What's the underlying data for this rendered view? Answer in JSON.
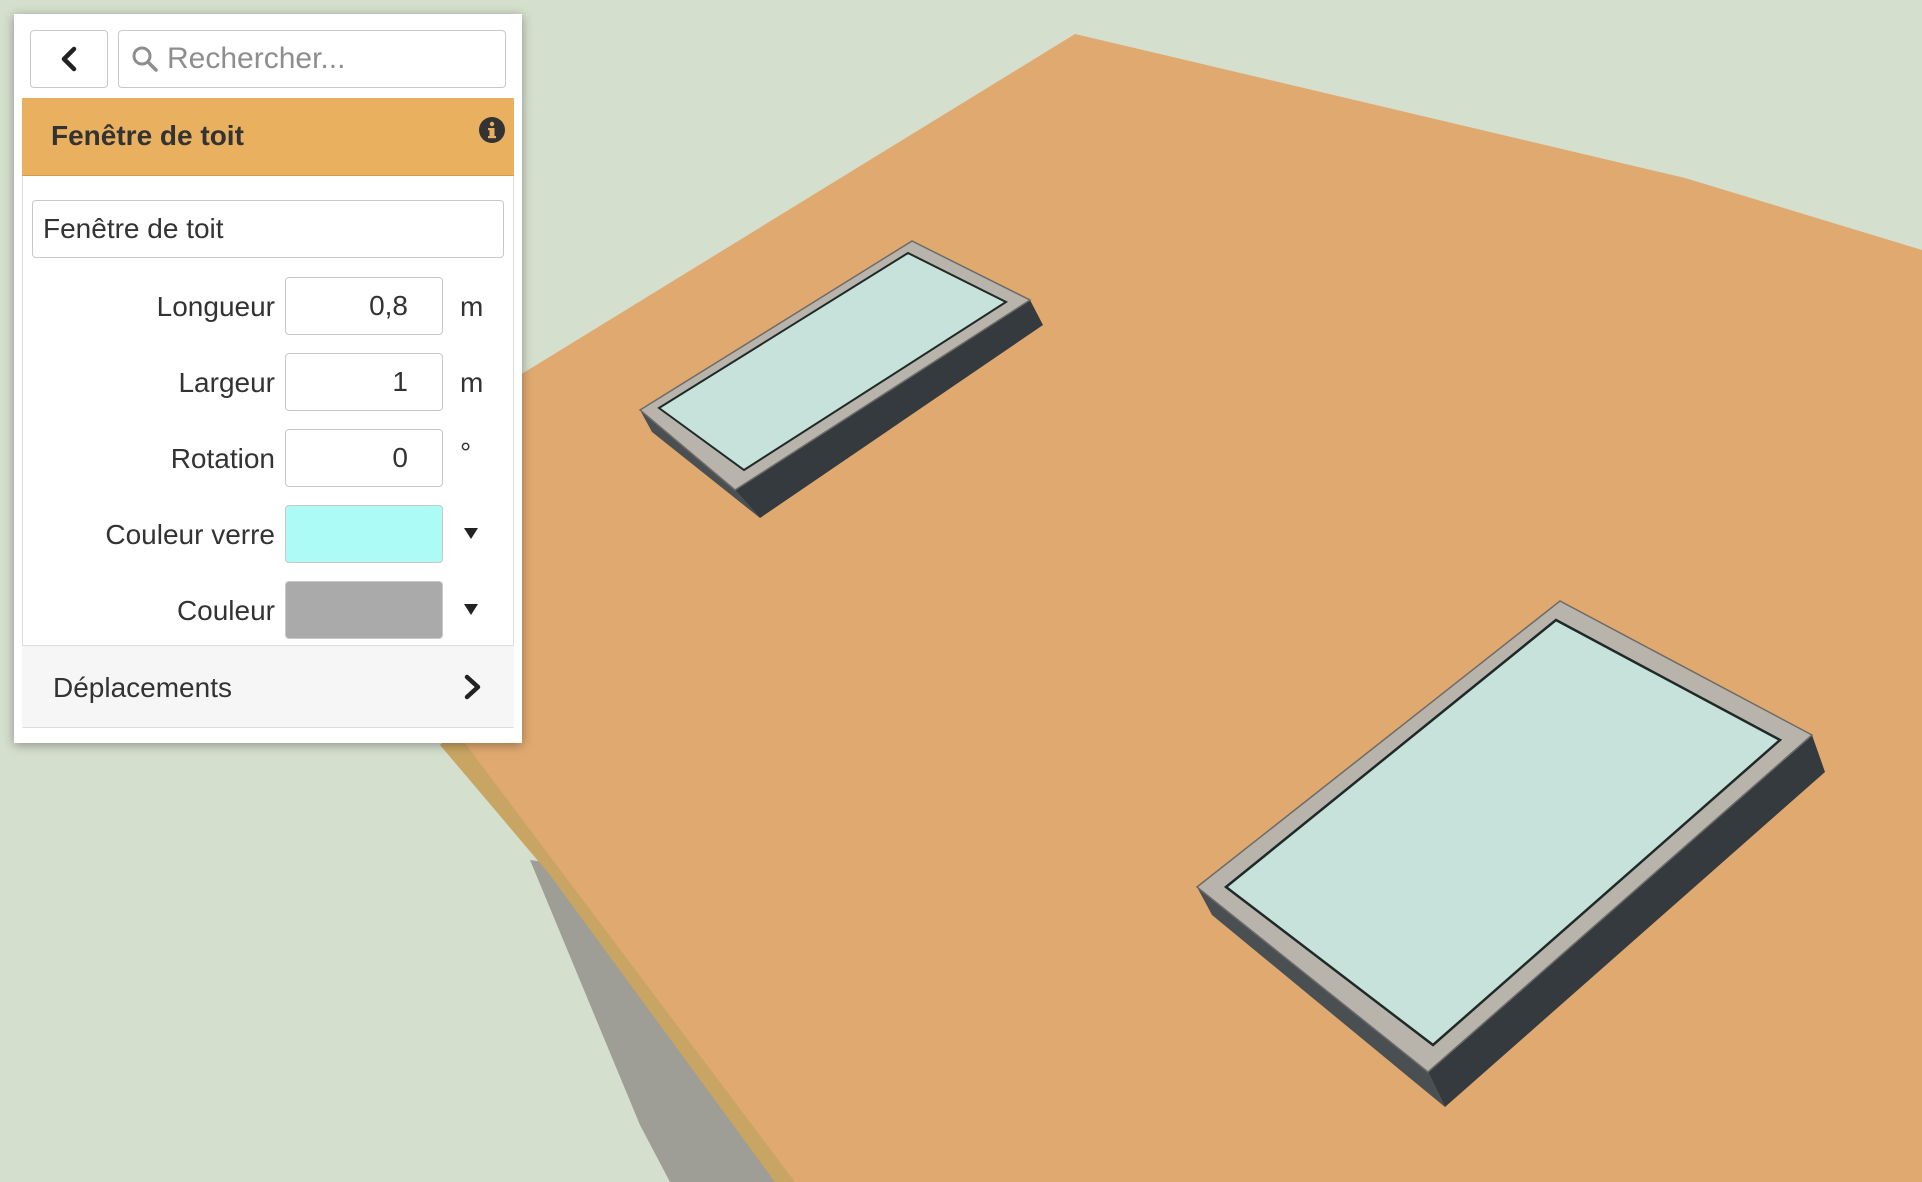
{
  "search": {
    "placeholder": "Rechercher..."
  },
  "panel": {
    "title": "Fenêtre de toit",
    "name_value": "Fenêtre de toit",
    "fields": [
      {
        "label": "Longueur",
        "value": "0,8",
        "unit": "m"
      },
      {
        "label": "Largeur",
        "value": "1",
        "unit": "m"
      },
      {
        "label": "Rotation",
        "value": "0",
        "unit": "°"
      }
    ],
    "colors": [
      {
        "label": "Couleur verre",
        "value": "#adfbf6"
      },
      {
        "label": "Couleur",
        "value": "#aaaaaa"
      }
    ],
    "moves_label": "Déplacements"
  },
  "scene": {
    "background": "#d5dfcd",
    "roof_color": "#e0a970",
    "glass_color": "#c7e2db",
    "frame_color": "#b8b3ab",
    "side_color": "#353a3e"
  },
  "icons": {
    "back": "chevron-left-icon",
    "search": "search-icon",
    "info": "info-icon",
    "dropdown": "caret-down-icon",
    "expand": "chevron-right-icon"
  }
}
